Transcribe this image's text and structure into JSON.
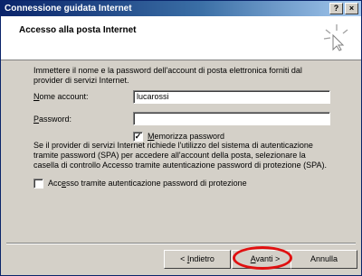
{
  "window": {
    "title": "Connessione guidata Internet",
    "help_glyph": "?",
    "close_glyph": "×"
  },
  "header": {
    "title": "Accesso alla posta Internet",
    "icon": "wizard-sparkle-icon"
  },
  "body": {
    "description": "Immettere il nome e la password dell'account di posta elettronica forniti dal provider di servizi Internet.",
    "account_label_u": "N",
    "account_label_rest": "ome account:",
    "account_value": "lucarossi",
    "password_label_u": "P",
    "password_label_rest": "assword:",
    "password_value": "",
    "remember_label_u": "M",
    "remember_label_rest": "emorizza password",
    "remember_checked": true,
    "spa_text": "Se il provider di servizi Internet richiede l'utilizzo del sistema di autenticazione tramite password (SPA) per accedere all'account della posta, selezionare la casella di controllo Accesso tramite autenticazione password di protezione (SPA).",
    "spa_label_pre": "Acc",
    "spa_label_u": "e",
    "spa_label_post": "sso tramite autenticazione password di protezione",
    "spa_checked": false
  },
  "buttons": {
    "back_pre": "< ",
    "back_u": "I",
    "back_post": "ndietro",
    "next_u": "A",
    "next_post": "vanti >",
    "cancel": "Annulla"
  },
  "colors": {
    "titlebar": "#0a246a",
    "highlight": "#e01010"
  }
}
